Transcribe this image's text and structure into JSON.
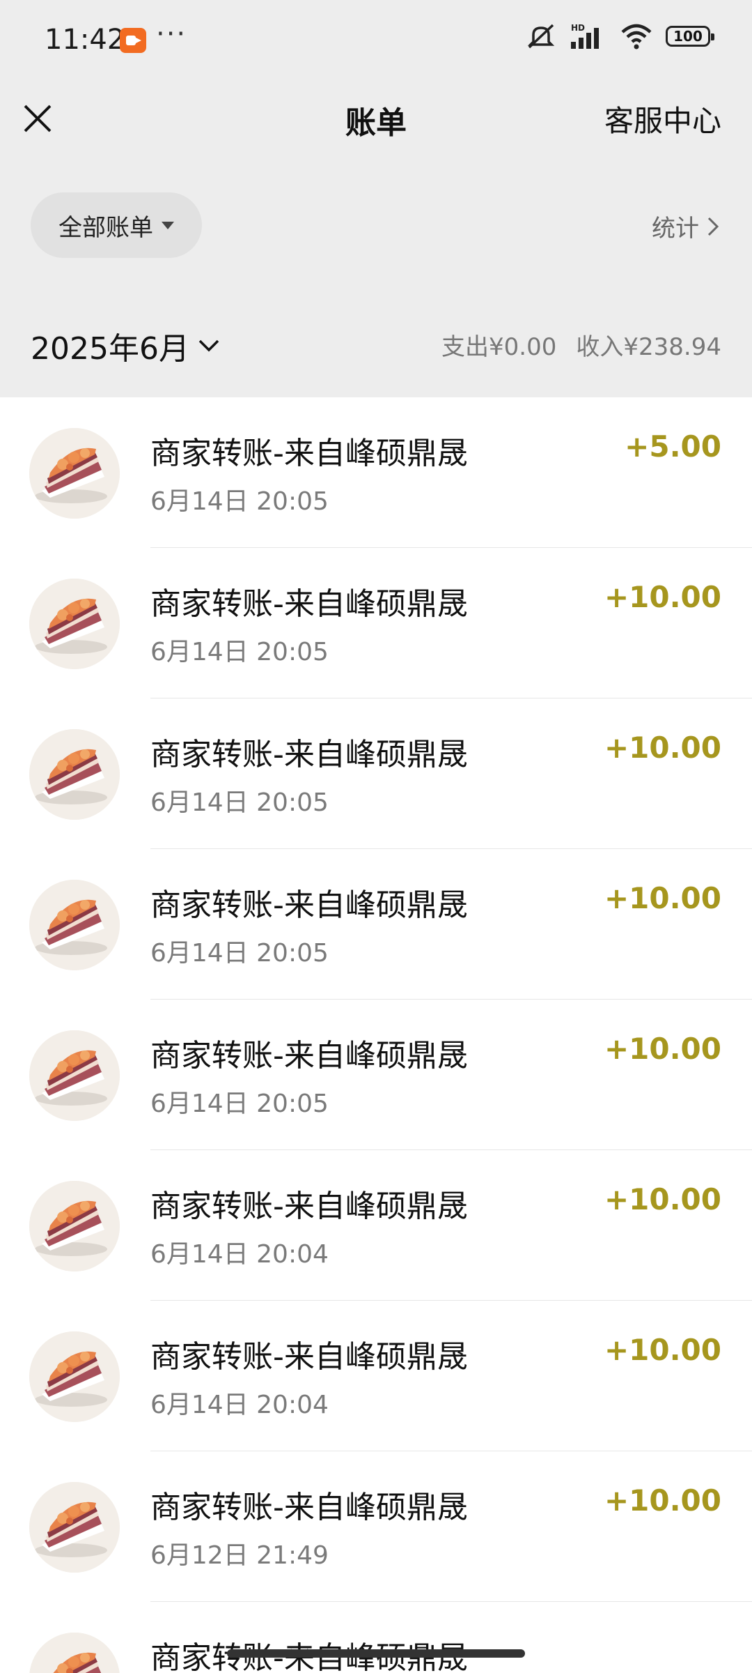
{
  "status_bar": {
    "time": "11:42",
    "dots": "···",
    "battery": "100"
  },
  "header": {
    "title": "账单",
    "service": "客服中心"
  },
  "filter": {
    "label": "全部账单",
    "stats": "统计"
  },
  "month": {
    "label": "2025年6月",
    "expense": "支出¥0.00",
    "income": "收入¥238.94"
  },
  "colors": {
    "amount": "#a6961e",
    "page_bg": "#ededed"
  },
  "transactions": [
    {
      "title": "商家转账-来自峰硕鼎晟",
      "time": "6月14日 20:05",
      "amount": "+5.00"
    },
    {
      "title": "商家转账-来自峰硕鼎晟",
      "time": "6月14日 20:05",
      "amount": "+10.00"
    },
    {
      "title": "商家转账-来自峰硕鼎晟",
      "time": "6月14日 20:05",
      "amount": "+10.00"
    },
    {
      "title": "商家转账-来自峰硕鼎晟",
      "time": "6月14日 20:05",
      "amount": "+10.00"
    },
    {
      "title": "商家转账-来自峰硕鼎晟",
      "time": "6月14日 20:05",
      "amount": "+10.00"
    },
    {
      "title": "商家转账-来自峰硕鼎晟",
      "time": "6月14日 20:04",
      "amount": "+10.00"
    },
    {
      "title": "商家转账-来自峰硕鼎晟",
      "time": "6月14日 20:04",
      "amount": "+10.00"
    },
    {
      "title": "商家转账-来自峰硕鼎晟",
      "time": "6月12日 21:49",
      "amount": "+10.00"
    },
    {
      "title": "商家转账-来自峰硕鼎晟",
      "time": "",
      "amount": ""
    }
  ]
}
